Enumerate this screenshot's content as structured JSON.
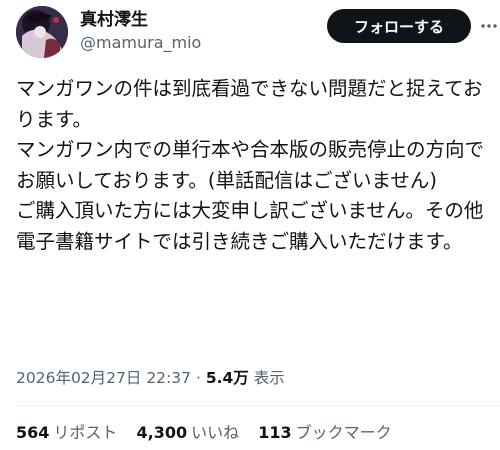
{
  "user": {
    "display_name": "真村澪生",
    "handle": "@mamura_mio"
  },
  "follow_button_label": "フォローする",
  "more_icon": "more-horizontal-icon",
  "tweet": {
    "paragraphs": [
      "マンガワンの件は到底看過できない問題だと捉えております。",
      "マンガワン内での単行本や合本版の販売停止の方向でお願いしております。(単話配信はございません)",
      "ご購入頂いた方には大変申し訳ございません。その他電子書籍サイトでは引き続きご購入いただけます。"
    ]
  },
  "meta": {
    "timestamp": "2026年02月27日 22:37",
    "separator": "·",
    "views_count": "5.4万",
    "views_label": "表示"
  },
  "stats": {
    "reposts_count": "564",
    "reposts_label": "リポスト",
    "likes_count": "4,300",
    "likes_label": "いいね",
    "bookmarks_count": "113",
    "bookmarks_label": "ブックマーク"
  },
  "colors": {
    "text_primary": "#0f1419",
    "text_secondary": "#536471",
    "button_bg": "#0f1419",
    "button_text": "#ffffff",
    "divider": "#eff3f4"
  }
}
